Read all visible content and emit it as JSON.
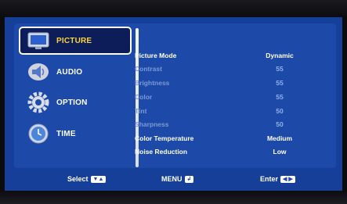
{
  "sidebar": {
    "items": [
      {
        "label": "PICTURE",
        "icon": "tv-icon",
        "selected": true
      },
      {
        "label": "AUDIO",
        "icon": "speaker-icon",
        "selected": false
      },
      {
        "label": "OPTION",
        "icon": "gear-icon",
        "selected": false
      },
      {
        "label": "TIME",
        "icon": "clock-icon",
        "selected": false
      }
    ]
  },
  "settings": [
    {
      "label": "Picture Mode",
      "value": "Dynamic",
      "enabled": true
    },
    {
      "label": "Contrast",
      "value": "55",
      "enabled": false
    },
    {
      "label": "Brightness",
      "value": "55",
      "enabled": false
    },
    {
      "label": "Color",
      "value": "55",
      "enabled": false
    },
    {
      "label": "Tint",
      "value": "50",
      "enabled": false
    },
    {
      "label": "Sharpness",
      "value": "50",
      "enabled": false
    },
    {
      "label": "Color Temperature",
      "value": "Medium",
      "enabled": true
    },
    {
      "label": "Noise Reduction",
      "value": "Low",
      "enabled": true
    }
  ],
  "footer": {
    "select_label": "Select",
    "select_key": "▼▲",
    "menu_label": "MENU",
    "menu_key": "↲",
    "enter_label": "Enter",
    "enter_key": "◀ ▶"
  },
  "colors": {
    "screen": "#163f9a",
    "panel": "#1d4aa8",
    "selected_label": "#ffd23a"
  }
}
